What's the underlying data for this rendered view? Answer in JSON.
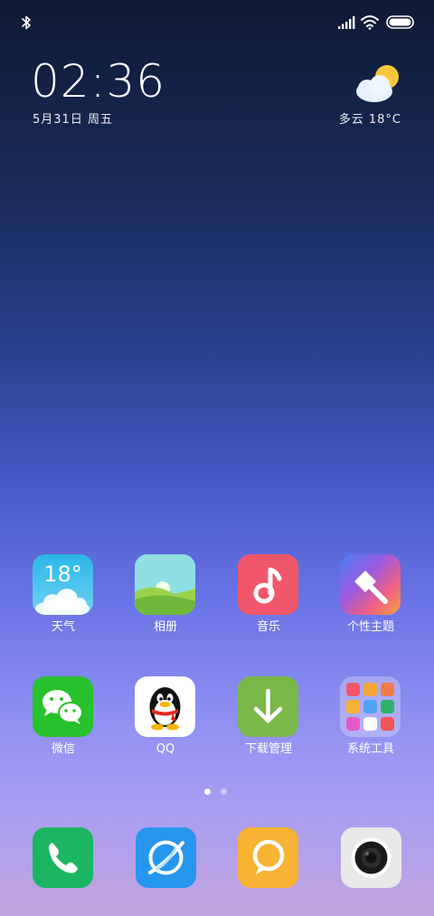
{
  "status_bar": {
    "icons": [
      "bluetooth-icon",
      "signal-icon",
      "wifi-icon",
      "battery-icon"
    ]
  },
  "clock_widget": {
    "time": "02:36",
    "date": "5月31日 周五",
    "weather_icon": "partly-cloudy-icon",
    "weather": "多云 18°C"
  },
  "apps": [
    {
      "label": "天气",
      "icon": "weather-app-icon",
      "badge_text": "18°"
    },
    {
      "label": "相册",
      "icon": "gallery-icon"
    },
    {
      "label": "音乐",
      "icon": "music-note-icon"
    },
    {
      "label": "个性主题",
      "icon": "paintbrush-icon"
    },
    {
      "label": "微信",
      "icon": "wechat-icon"
    },
    {
      "label": "QQ",
      "icon": "qq-penguin-icon"
    },
    {
      "label": "下载管理",
      "icon": "download-arrow-icon"
    },
    {
      "label": "系统工具",
      "icon": "folder-icon"
    }
  ],
  "page_indicator": {
    "pages": 2,
    "current": 1
  },
  "dock": [
    {
      "icon": "phone-icon"
    },
    {
      "icon": "browser-icon"
    },
    {
      "icon": "messages-icon"
    },
    {
      "icon": "camera-icon"
    }
  ],
  "colors": {
    "wallpaper_top": "#0f1a33",
    "wallpaper_bottom": "#c2a5df",
    "text": "#ffffff"
  }
}
